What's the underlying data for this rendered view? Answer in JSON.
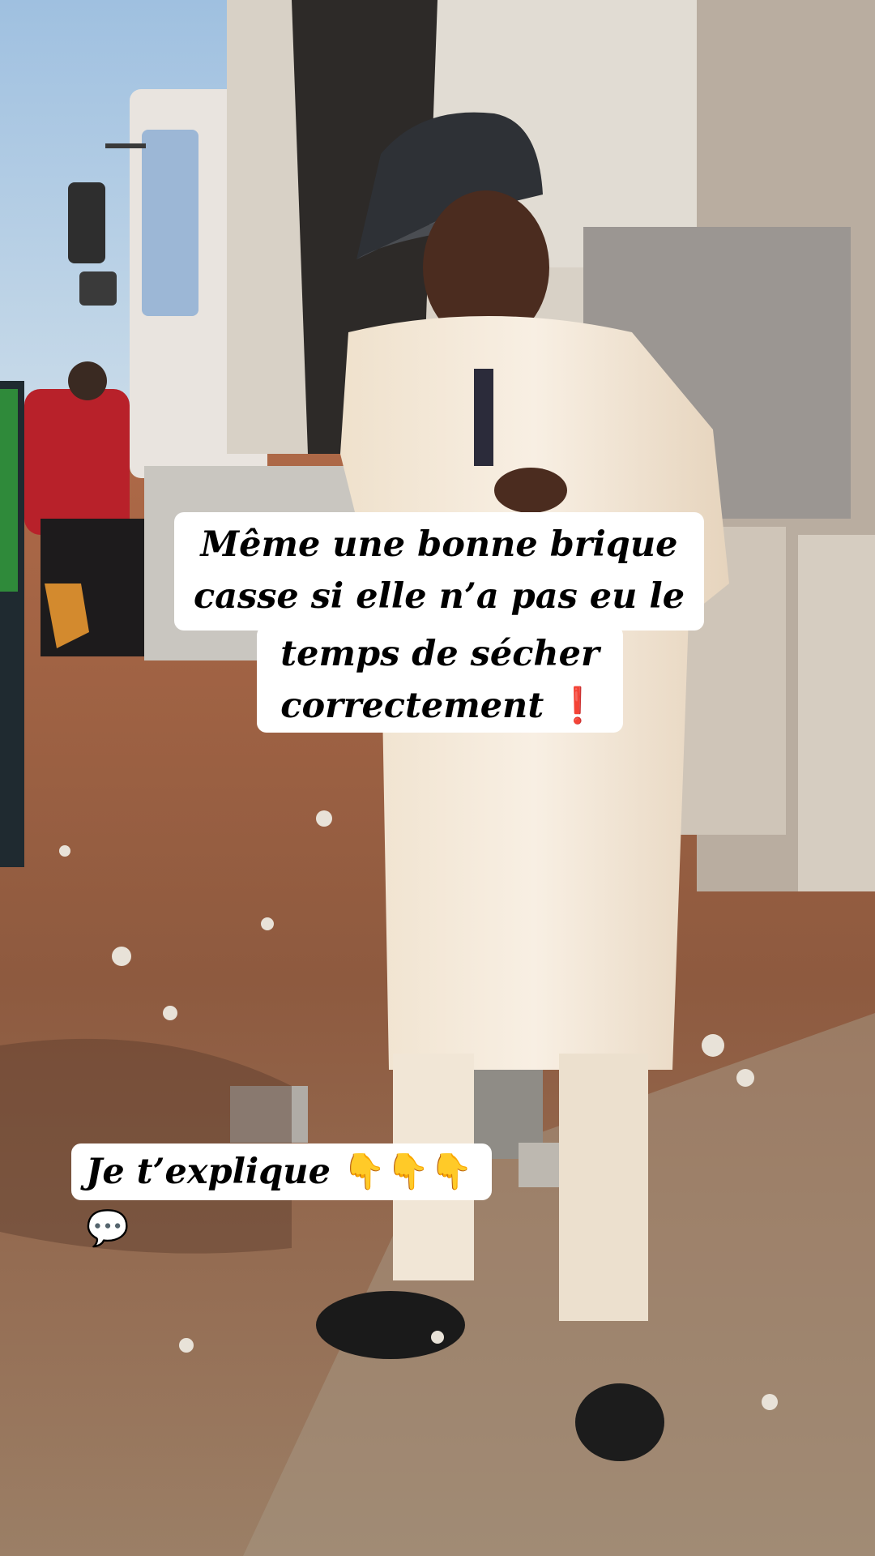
{
  "captions": {
    "main_line1": "Même une bonne brique",
    "main_line2": "casse si elle n’a pas eu le",
    "main_line3": "temps de sécher",
    "main_line4": "correctement",
    "main_line4_emoji": "❗",
    "secondary_text": "Je t’explique",
    "secondary_emojis": "👇👇👇💬"
  },
  "colors": {
    "caption_background": "#ffffff",
    "caption_text": "#000000",
    "exclamation": "#e0201b",
    "sky": "#a9c9e4",
    "ground": "#9a5a3e",
    "outfit": "#f3e8d8"
  }
}
